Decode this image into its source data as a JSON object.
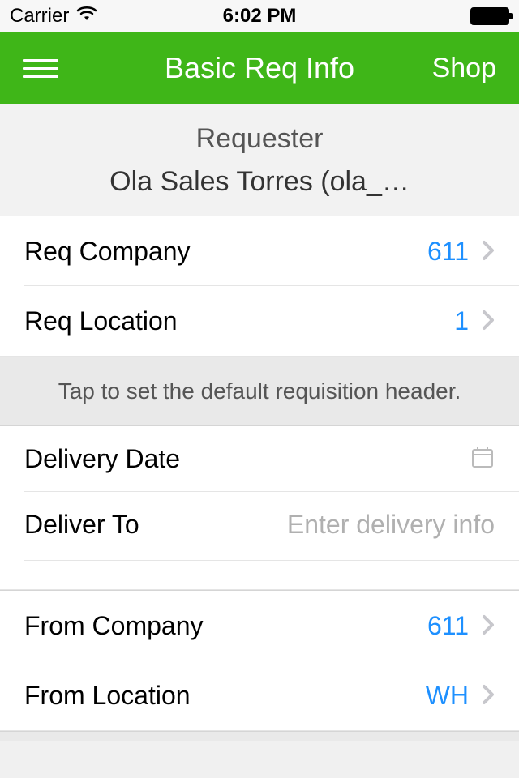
{
  "statusBar": {
    "carrier": "Carrier",
    "time": "6:02 PM"
  },
  "navBar": {
    "title": "Basic Req Info",
    "action": "Shop"
  },
  "requester": {
    "label": "Requester",
    "name": "Ola Sales Torres (ola_…"
  },
  "rows": {
    "reqCompany": {
      "label": "Req Company",
      "value": "611"
    },
    "reqLocation": {
      "label": "Req Location",
      "value": "1"
    },
    "deliveryDate": {
      "label": "Delivery Date"
    },
    "deliverTo": {
      "label": "Deliver To",
      "placeholder": "Enter delivery info"
    },
    "fromCompany": {
      "label": "From Company",
      "value": "611"
    },
    "fromLocation": {
      "label": "From Location",
      "value": "WH"
    }
  },
  "sectionHeader": "Tap to set the default requisition header."
}
